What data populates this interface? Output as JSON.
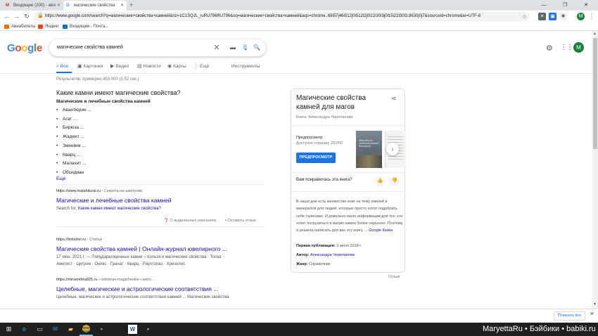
{
  "browser": {
    "tabs": [
      {
        "title": "Входящие (200) - alex",
        "favicon": "gmail-icon"
      },
      {
        "title": "магические свойства",
        "favicon": "google-icon"
      }
    ],
    "url": "https://www.google.com/search?q=магические+свойства+камней&rlz=1C1SQJL_ruRU796RU796&oq=магические+свойства+камней&aqs=chrome..69i57j46i512j0i512l2j0i22i30l3j0i15i22i30l3.8630j0j7&sourceid=chrome&ie=UTF-8",
    "profile_letter": "M",
    "bookmarks": [
      {
        "label": "Авиабилеты",
        "color": "#e8710a"
      },
      {
        "label": "Яндекс",
        "color": "#fc3f1d"
      },
      {
        "label": "Входящие - Почта...",
        "color": "#0072c6"
      }
    ]
  },
  "google": {
    "logo": "Google",
    "query": "магические свойства камней",
    "avatar_letter": "M",
    "tabs": [
      {
        "label": "Все",
        "icon": "search-icon"
      },
      {
        "label": "Картинки",
        "icon": "image-icon"
      },
      {
        "label": "Видео",
        "icon": "video-icon"
      },
      {
        "label": "Новости",
        "icon": "news-icon"
      },
      {
        "label": "Карты",
        "icon": "map-pin-icon"
      },
      {
        "label": "Ещё",
        "icon": "more-vert-icon"
      }
    ],
    "tools": "Инструменты",
    "stats": "Результатов: примерно 453 000 (0,52 сек.)"
  },
  "featured": {
    "question": "Какие камни имеют магические свойства?",
    "heading": "Магические и лечебные свойства камней",
    "items": [
      "Авантюрин ...",
      "Агат ...",
      "Бирюза ...",
      "Жадеит ...",
      "Змеевик ...",
      "Кварц ...",
      "Малахит ...",
      "Обсидиан"
    ],
    "more": "Ещё",
    "cite_domain": "https://www.malahitural.ru",
    "cite_path": " › Секреты из шкатулки",
    "title": "Магические и лечебные свойства камней",
    "search_for_prefix": "Search for: ",
    "search_for_link": "Какие камни имеют магические свойства?",
    "about_snippets": "О выделенных описаниях",
    "feedback": "Оставить отзыв"
  },
  "results": [
    {
      "cite_domain": "https://liniilubvi.ru",
      "cite_path": " › Статьи",
      "title": "Магические свойства камней | Онлайн-журнал ювелирного ...",
      "snippet1": "17 июн. 2021 г. — Попударагоценные камни – пользя и магические свойства · Топаз ·",
      "snippet2": "Аметист · Цитрин · Оникс · Гранат · Кварц · Раухтопаз · Хризолит."
    },
    {
      "cite_domain": "https://mirserebra925.ru",
      "cite_path": " › celebnye-magicheskie-i-astro...",
      "title": "Целебные, магические и астрологические соответствия ...",
      "snippet1": "Целебные, магические и астрологические соответствия камней ... Магические свойства"
    }
  ],
  "knowledge_panel": {
    "title": "Магические свойства камней для магов",
    "subtitle": "Книга, Александра Черепанова",
    "preview_label": "Предпросмотр",
    "pages_available": "Доступно страниц: 26/260",
    "preview_button": "ПРЕДПРОСМОТР",
    "cover_text": "Магические свойства камней для магов",
    "like_question": "Вам понравилась эта книга?",
    "description": "В наши дни есть множество книг на тему камней и минералов для людей, которые просто хотят подобрать себе талисман. И довольно мало информации для тех, кто хочет погрузиться в магию камня более серьезно. Поэтому я решила написать для вас эту книгу. ...",
    "desc_link": "Google Книги",
    "first_pub_label": "Первая публикация:",
    "first_pub_value": " 3 июля 2018 г.",
    "author_label": "Автор:",
    "author_value": "Александра Черепанова",
    "genre_label": "Жанр:",
    "genre_value": " Справочник",
    "feedback": "Отзыв"
  },
  "downloads": {
    "show_all": "Показать все"
  },
  "watermark": "MaryettaRu • Бэйбики • babiki.ru"
}
